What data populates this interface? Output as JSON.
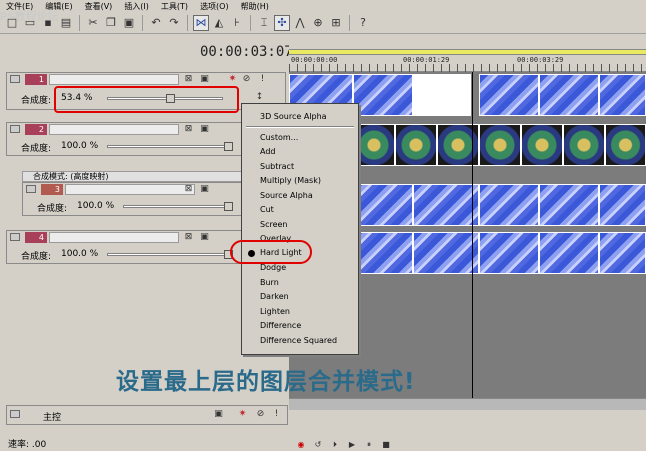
{
  "watermark": "PS教程论坛",
  "menu": [
    "文件(E)",
    "编辑(E)",
    "查看(V)",
    "插入(I)",
    "工具(T)",
    "选项(O)",
    "帮助(H)"
  ],
  "toolbar": {
    "icons": [
      "new-icon",
      "open-icon",
      "save-icon",
      "properties-icon",
      "cut-icon",
      "copy-icon",
      "paste-icon",
      "undo-icon",
      "redo-icon",
      "snap-icon",
      "marker-icon",
      "auto-ripple-icon",
      "trim-icon",
      "select-icon",
      "envelope-icon",
      "zoom-icon",
      "scrub-icon"
    ]
  },
  "timecode": "00:00:03:07",
  "ruler": {
    "ticks": [
      "00:00:00:00",
      "00:00:01:29",
      "00:00:03:29"
    ]
  },
  "tracks": [
    {
      "number": "1",
      "opacity_label": "合成度:",
      "opacity_value": "53.4 %",
      "opacity_level": 0.534
    },
    {
      "number": "2",
      "opacity_label": "合成度:",
      "opacity_value": "100.0 %",
      "opacity_level": 1.0
    },
    {
      "number": "3",
      "opacity_label": "合成度:",
      "opacity_value": "100.0 %",
      "opacity_level": 1.0
    },
    {
      "number": "4",
      "opacity_label": "合成度:",
      "opacity_value": "100.0 %",
      "opacity_level": 1.0
    }
  ],
  "composite_mode_label": "合成模式: (高度映射)",
  "master": {
    "label": "主控"
  },
  "rate": {
    "label": "速率:",
    "value": ".00"
  },
  "context_menu": {
    "items": [
      "3D Source Alpha",
      "Custom...",
      "Add",
      "Subtract",
      "Multiply (Mask)",
      "Source Alpha",
      "Cut",
      "Screen",
      "Overlay",
      "Hard Light",
      "Dodge",
      "Burn",
      "Darken",
      "Lighten",
      "Difference",
      "Difference Squared"
    ],
    "selected": "Hard Light"
  },
  "caption": "设置最上层的图层合并模式!",
  "colors": {
    "highlight_circle": "#e00000",
    "caption": "#2a6a8a",
    "track_number": "#a8405a"
  }
}
